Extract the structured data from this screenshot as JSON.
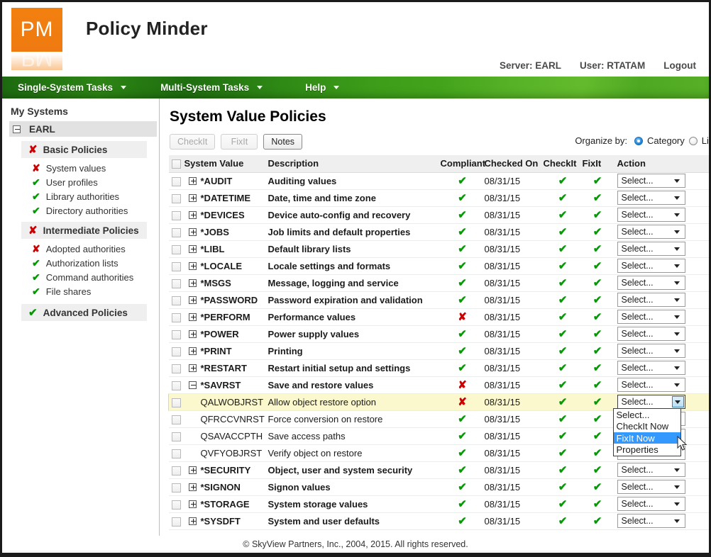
{
  "app": {
    "logo_text": "PM",
    "title": "Policy Minder",
    "server": "Server: EARL",
    "user": "User: RTATAM",
    "logout": "Logout"
  },
  "nav": {
    "items": [
      {
        "label": "Single-System Tasks"
      },
      {
        "label": "Multi-System Tasks"
      },
      {
        "label": "Help"
      }
    ]
  },
  "sidebar": {
    "title": "My Systems",
    "system": "EARL",
    "groups": [
      {
        "label": "Basic Policies",
        "status": "bad",
        "children": [
          {
            "label": "System values",
            "status": "bad"
          },
          {
            "label": "User profiles",
            "status": "ok"
          },
          {
            "label": "Library authorities",
            "status": "ok"
          },
          {
            "label": "Directory authorities",
            "status": "ok"
          }
        ]
      },
      {
        "label": "Intermediate Policies",
        "status": "bad",
        "children": [
          {
            "label": "Adopted authorities",
            "status": "bad"
          },
          {
            "label": "Authorization lists",
            "status": "ok"
          },
          {
            "label": "Command authorities",
            "status": "ok"
          },
          {
            "label": "File shares",
            "status": "ok"
          }
        ]
      },
      {
        "label": "Advanced Policies",
        "status": "ok",
        "children": []
      }
    ]
  },
  "main": {
    "page_title": "System Value Policies",
    "buttons": {
      "checkit": "CheckIt",
      "fixit": "FixIt",
      "notes": "Notes"
    },
    "organize": {
      "label": "Organize by:",
      "option_category": "Category",
      "option_list": "List",
      "selected": "Category"
    },
    "columns": {
      "system_value": "System Value",
      "description": "Description",
      "compliant": "Compliant",
      "checked_on": "Checked On",
      "checkit": "CheckIt",
      "fixit": "FixIt",
      "action": "Action"
    },
    "select_placeholder": "Select...",
    "dropdown_options": [
      "Select...",
      "CheckIt Now",
      "FixIt Now",
      "Properties"
    ],
    "dropdown_highlighted": "FixIt Now",
    "rows": [
      {
        "name": "*AUDIT",
        "desc": "Auditing values",
        "compliant": "ok",
        "checked_on": "08/31/15",
        "checkit": "ok",
        "fixit": "ok",
        "action": "Select...",
        "expander": "plus",
        "child": false,
        "highlight": false
      },
      {
        "name": "*DATETIME",
        "desc": "Date, time and time zone",
        "compliant": "ok",
        "checked_on": "08/31/15",
        "checkit": "ok",
        "fixit": "ok",
        "action": "Select...",
        "expander": "plus",
        "child": false,
        "highlight": false
      },
      {
        "name": "*DEVICES",
        "desc": "Device auto-config and recovery",
        "compliant": "ok",
        "checked_on": "08/31/15",
        "checkit": "ok",
        "fixit": "ok",
        "action": "Select...",
        "expander": "plus",
        "child": false,
        "highlight": false
      },
      {
        "name": "*JOBS",
        "desc": "Job limits and default properties",
        "compliant": "ok",
        "checked_on": "08/31/15",
        "checkit": "ok",
        "fixit": "ok",
        "action": "Select...",
        "expander": "plus",
        "child": false,
        "highlight": false
      },
      {
        "name": "*LIBL",
        "desc": "Default library lists",
        "compliant": "ok",
        "checked_on": "08/31/15",
        "checkit": "ok",
        "fixit": "ok",
        "action": "Select...",
        "expander": "plus",
        "child": false,
        "highlight": false
      },
      {
        "name": "*LOCALE",
        "desc": "Locale settings and formats",
        "compliant": "ok",
        "checked_on": "08/31/15",
        "checkit": "ok",
        "fixit": "ok",
        "action": "Select...",
        "expander": "plus",
        "child": false,
        "highlight": false
      },
      {
        "name": "*MSGS",
        "desc": "Message, logging and service",
        "compliant": "ok",
        "checked_on": "08/31/15",
        "checkit": "ok",
        "fixit": "ok",
        "action": "Select...",
        "expander": "plus",
        "child": false,
        "highlight": false
      },
      {
        "name": "*PASSWORD",
        "desc": "Password expiration and validation",
        "compliant": "ok",
        "checked_on": "08/31/15",
        "checkit": "ok",
        "fixit": "ok",
        "action": "Select...",
        "expander": "plus",
        "child": false,
        "highlight": false
      },
      {
        "name": "*PERFORM",
        "desc": "Performance values",
        "compliant": "bad",
        "checked_on": "08/31/15",
        "checkit": "ok",
        "fixit": "ok",
        "action": "Select...",
        "expander": "plus",
        "child": false,
        "highlight": false
      },
      {
        "name": "*POWER",
        "desc": "Power supply values",
        "compliant": "ok",
        "checked_on": "08/31/15",
        "checkit": "ok",
        "fixit": "ok",
        "action": "Select...",
        "expander": "plus",
        "child": false,
        "highlight": false
      },
      {
        "name": "*PRINT",
        "desc": "Printing",
        "compliant": "ok",
        "checked_on": "08/31/15",
        "checkit": "ok",
        "fixit": "ok",
        "action": "Select...",
        "expander": "plus",
        "child": false,
        "highlight": false
      },
      {
        "name": "*RESTART",
        "desc": "Restart initial setup and settings",
        "compliant": "ok",
        "checked_on": "08/31/15",
        "checkit": "ok",
        "fixit": "ok",
        "action": "Select...",
        "expander": "plus",
        "child": false,
        "highlight": false
      },
      {
        "name": "*SAVRST",
        "desc": "Save and restore values",
        "compliant": "bad",
        "checked_on": "08/31/15",
        "checkit": "ok",
        "fixit": "ok",
        "action": "Select...",
        "expander": "minus",
        "child": false,
        "highlight": false
      },
      {
        "name": "QALWOBJRST",
        "desc": "Allow object restore option",
        "compliant": "bad",
        "checked_on": "08/31/15",
        "checkit": "ok",
        "fixit": "ok",
        "action": "Select...",
        "expander": "none",
        "child": true,
        "highlight": true
      },
      {
        "name": "QFRCCVNRST",
        "desc": "Force conversion on restore",
        "compliant": "ok",
        "checked_on": "08/31/15",
        "checkit": "ok",
        "fixit": "ok",
        "action": "Select...",
        "expander": "none",
        "child": true,
        "highlight": false
      },
      {
        "name": "QSAVACCPTH",
        "desc": "Save access paths",
        "compliant": "ok",
        "checked_on": "08/31/15",
        "checkit": "ok",
        "fixit": "ok",
        "action": "Select...",
        "expander": "none",
        "child": true,
        "highlight": false
      },
      {
        "name": "QVFYOBJRST",
        "desc": "Verify object on restore",
        "compliant": "ok",
        "checked_on": "08/31/15",
        "checkit": "ok",
        "fixit": "ok",
        "action": "Select...",
        "expander": "none",
        "child": true,
        "highlight": false
      },
      {
        "name": "*SECURITY",
        "desc": "Object, user and system security",
        "compliant": "ok",
        "checked_on": "08/31/15",
        "checkit": "ok",
        "fixit": "ok",
        "action": "Select...",
        "expander": "plus",
        "child": false,
        "highlight": false
      },
      {
        "name": "*SIGNON",
        "desc": "Signon values",
        "compliant": "ok",
        "checked_on": "08/31/15",
        "checkit": "ok",
        "fixit": "ok",
        "action": "Select...",
        "expander": "plus",
        "child": false,
        "highlight": false
      },
      {
        "name": "*STORAGE",
        "desc": "System storage values",
        "compliant": "ok",
        "checked_on": "08/31/15",
        "checkit": "ok",
        "fixit": "ok",
        "action": "Select...",
        "expander": "plus",
        "child": false,
        "highlight": false
      },
      {
        "name": "*SYSDFT",
        "desc": "System and user defaults",
        "compliant": "ok",
        "checked_on": "08/31/15",
        "checkit": "ok",
        "fixit": "ok",
        "action": "Select...",
        "expander": "plus",
        "child": false,
        "highlight": false
      }
    ],
    "open_dropdown_row_index": 13
  },
  "footer": {
    "copyright": "© SkyView Partners, Inc., 2004, 2015. All rights reserved."
  },
  "icons": {
    "tick": "✔",
    "cross": "✘"
  },
  "colors": {
    "brand_orange": "#F2800F",
    "nav_green_dark": "#1D6A10",
    "nav_green_light": "#63BB2C",
    "ok_green": "#089808",
    "bad_red": "#CC0000",
    "highlight_yellow": "#FBF8CD",
    "dropdown_blue": "#3399FF"
  }
}
